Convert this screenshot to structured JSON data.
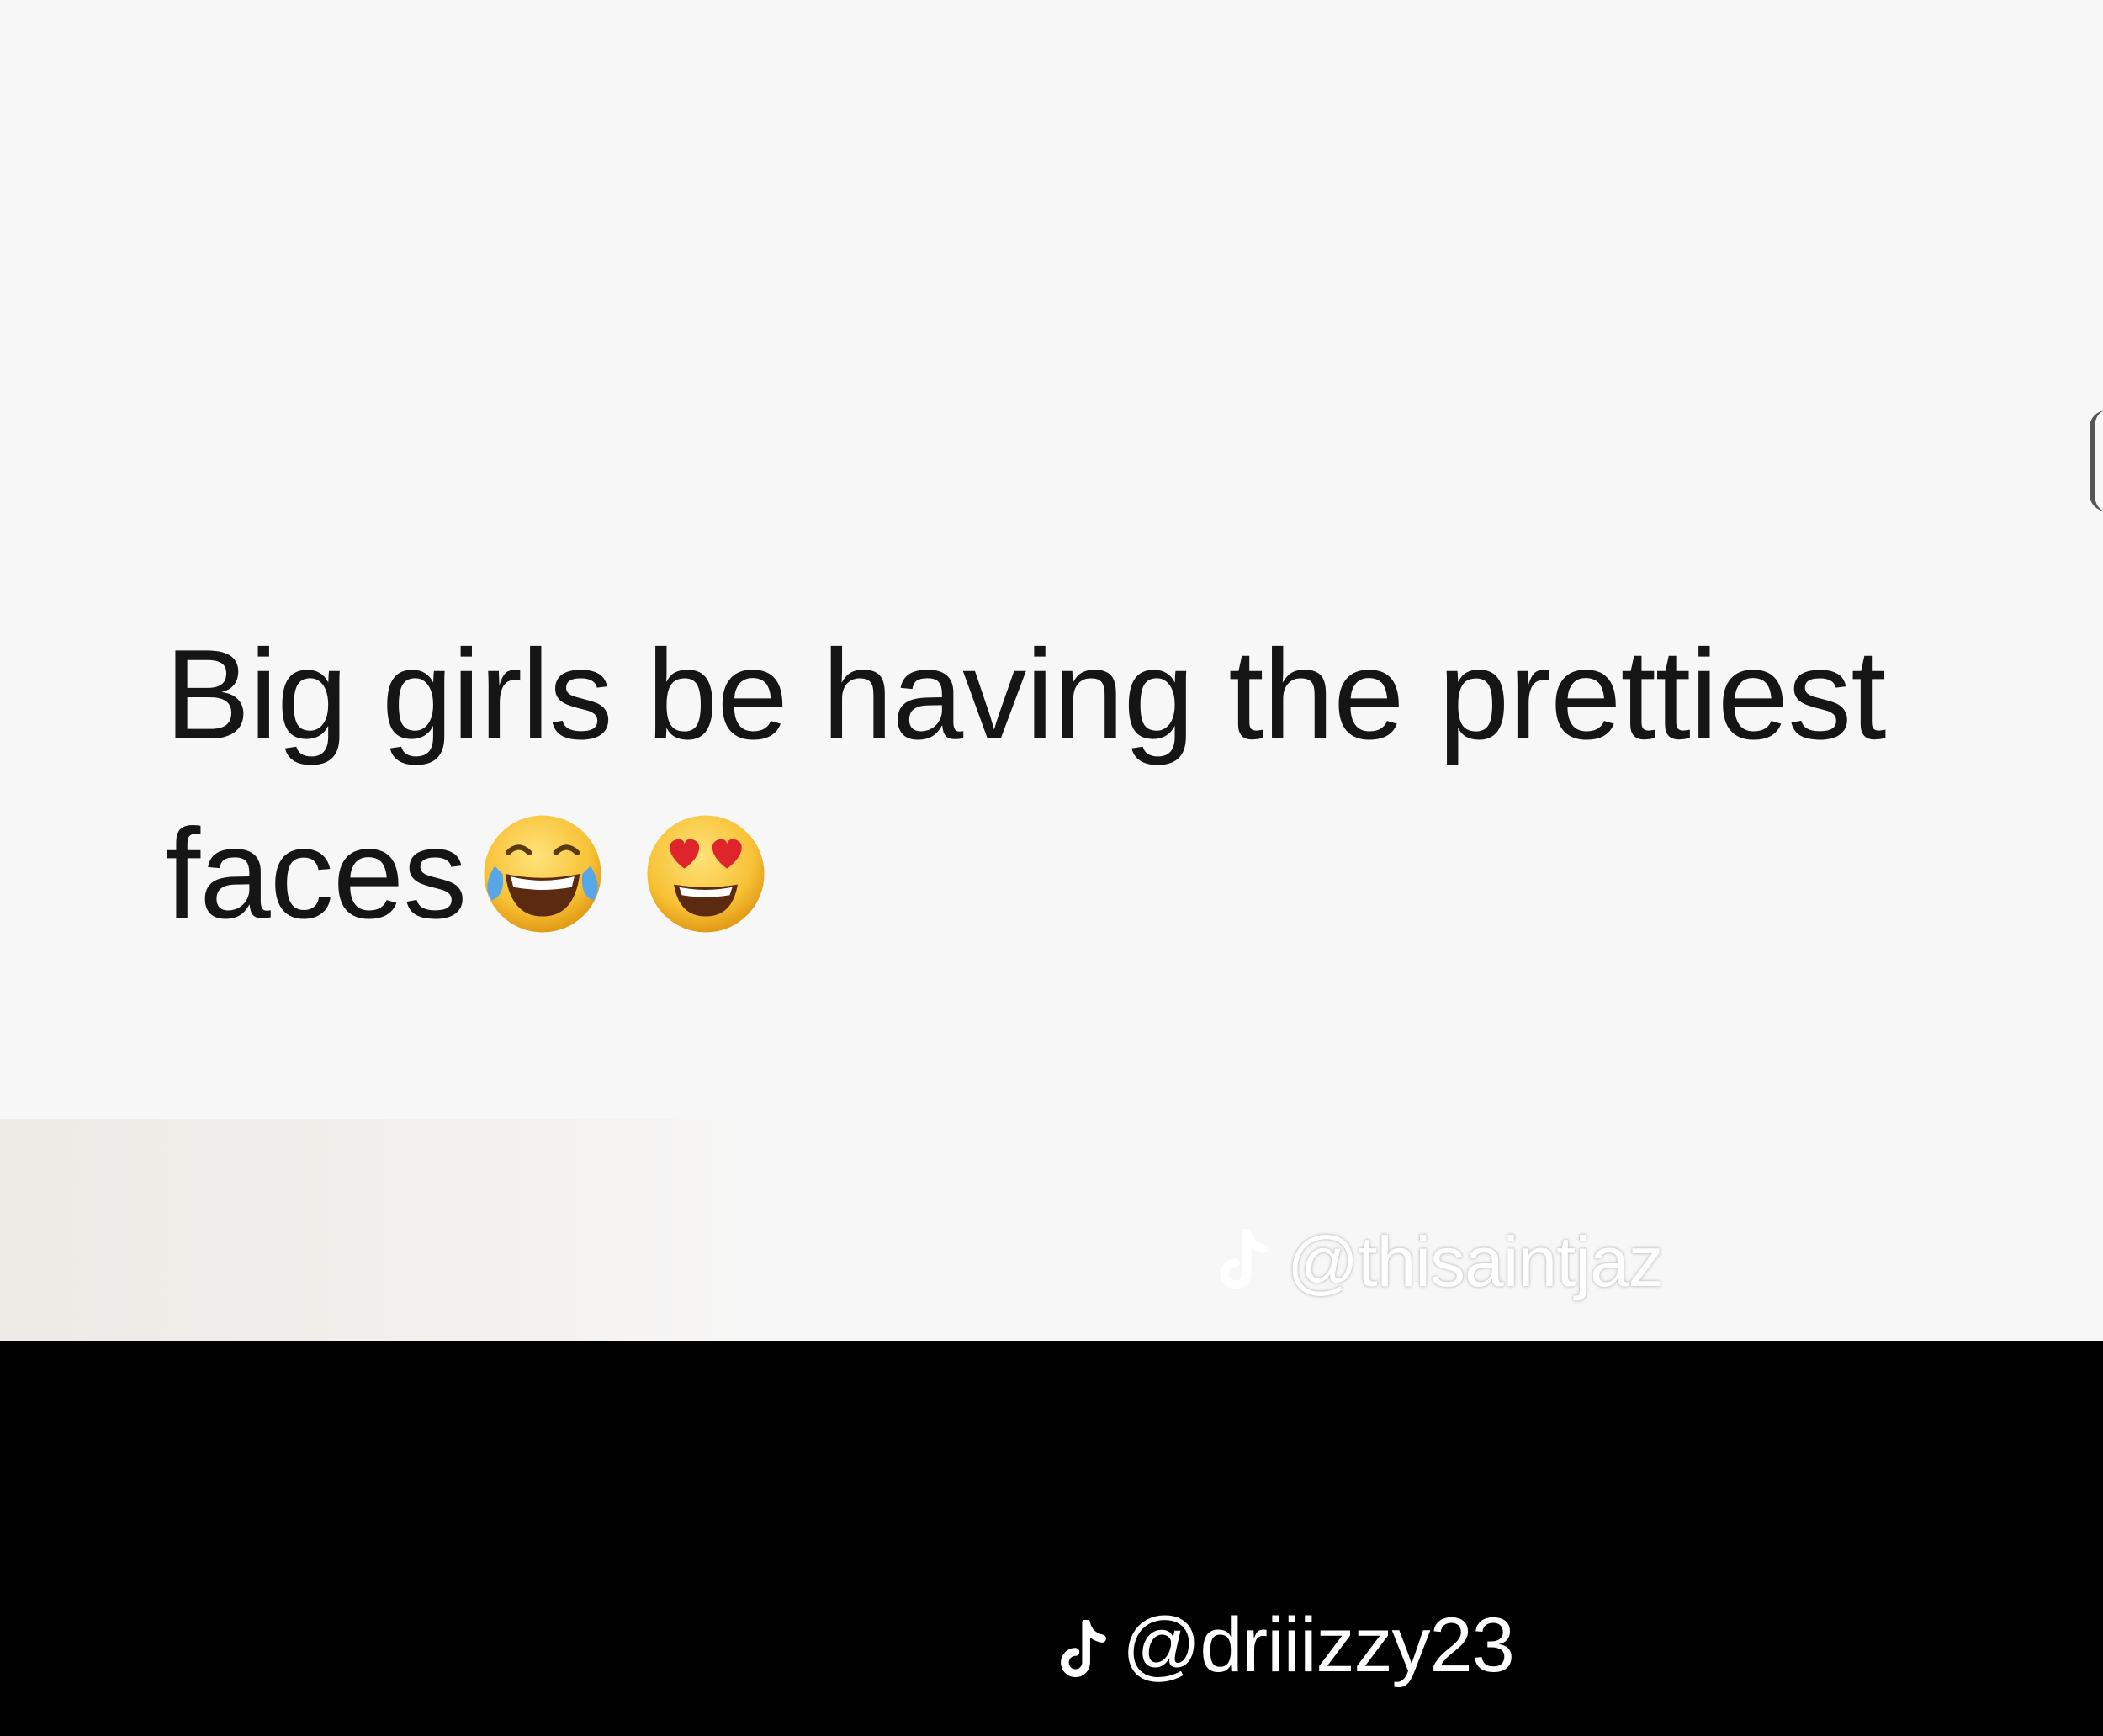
{
  "post": {
    "line1": "Big girls be having the prettiest",
    "line2": "faces"
  },
  "emojis": [
    "face-with-tears-of-joy-icon",
    "heart-eyes-icon"
  ],
  "watermark_inner": {
    "icon": "tiktok-logo-icon",
    "handle": "@thisaintjaz"
  },
  "watermark_outer": {
    "icon": "tiktok-logo-icon",
    "handle": "@driiizzy23"
  },
  "colors": {
    "post_background": "#f7f7f7",
    "text": "#151515",
    "bottom_bar": "#000000",
    "watermark": "#ffffff"
  }
}
